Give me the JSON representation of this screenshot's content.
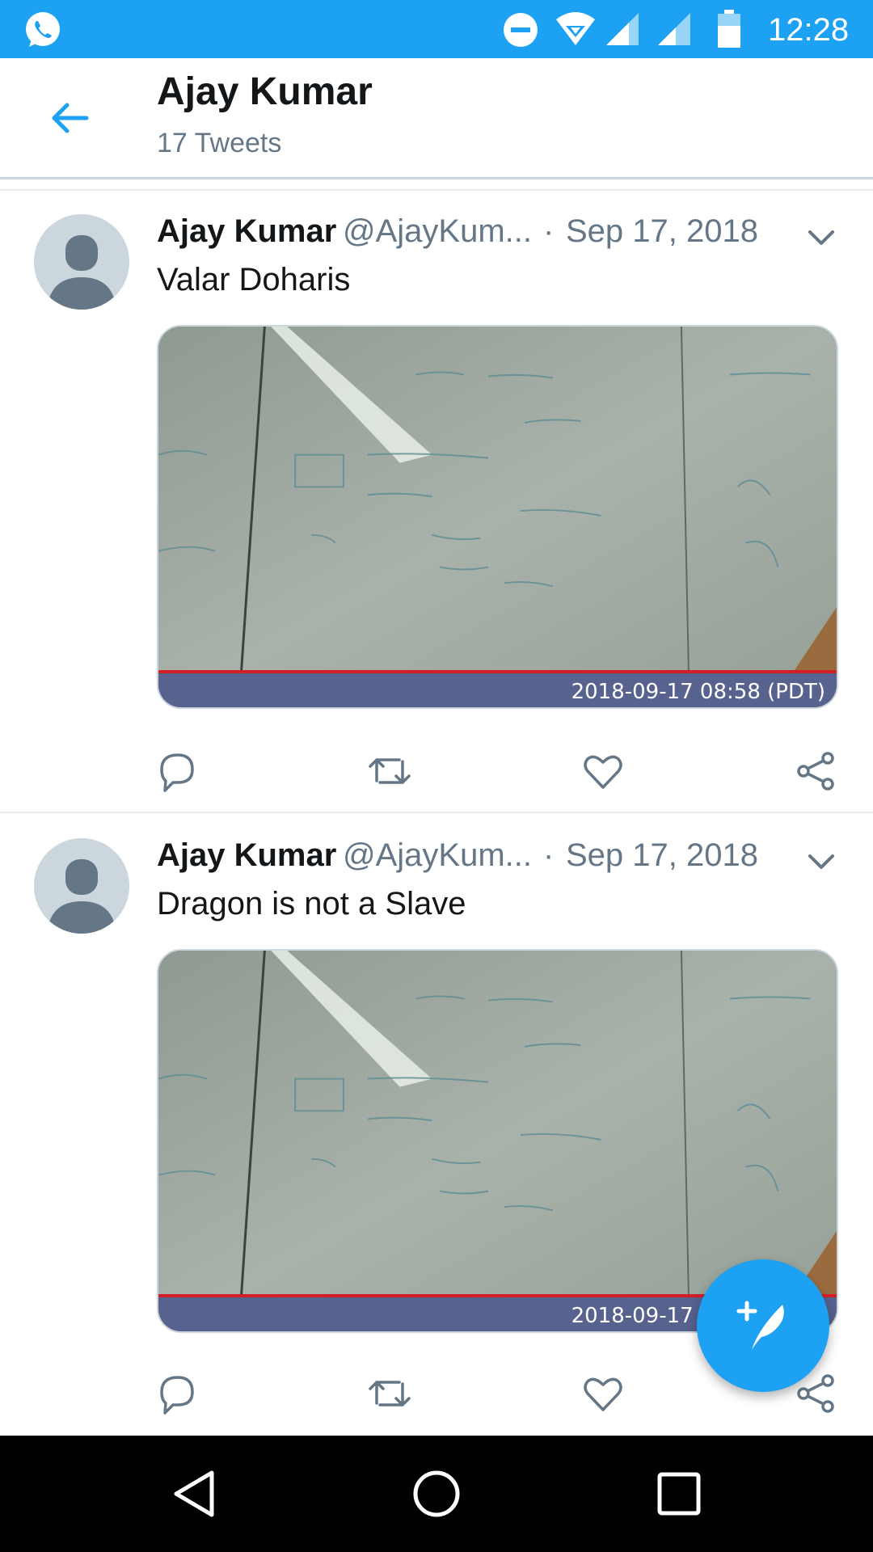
{
  "status_bar": {
    "time": "12:28",
    "icons": [
      "whatsapp-icon",
      "do-not-disturb-icon",
      "wifi-icon",
      "signal-icon",
      "signal-icon",
      "battery-icon"
    ],
    "color": "#1da1f2"
  },
  "header": {
    "title": "Ajay Kumar",
    "subtitle": "17 Tweets"
  },
  "tweets": [
    {
      "name": "Ajay Kumar",
      "handle": "@AjayKum...",
      "separator": "·",
      "date": "Sep 17, 2018",
      "text": "Valar Doharis",
      "media_timestamp": "2018-09-17 08:58 (PDT)"
    },
    {
      "name": "Ajay Kumar",
      "handle": "@AjayKum...",
      "separator": "·",
      "date": "Sep 17, 2018",
      "text": "Dragon is not a Slave",
      "media_timestamp": "2018-09-17 08:58 (PDT)"
    }
  ],
  "actions": [
    "reply-icon",
    "retweet-icon",
    "like-icon",
    "share-icon"
  ],
  "fab": {
    "icon": "compose-tweet-icon"
  },
  "nav_bar": {
    "buttons": [
      "back",
      "home",
      "recents"
    ]
  },
  "colors": {
    "accent": "#1da1f2",
    "secondary_text": "#657786",
    "primary_text": "#14171a"
  }
}
